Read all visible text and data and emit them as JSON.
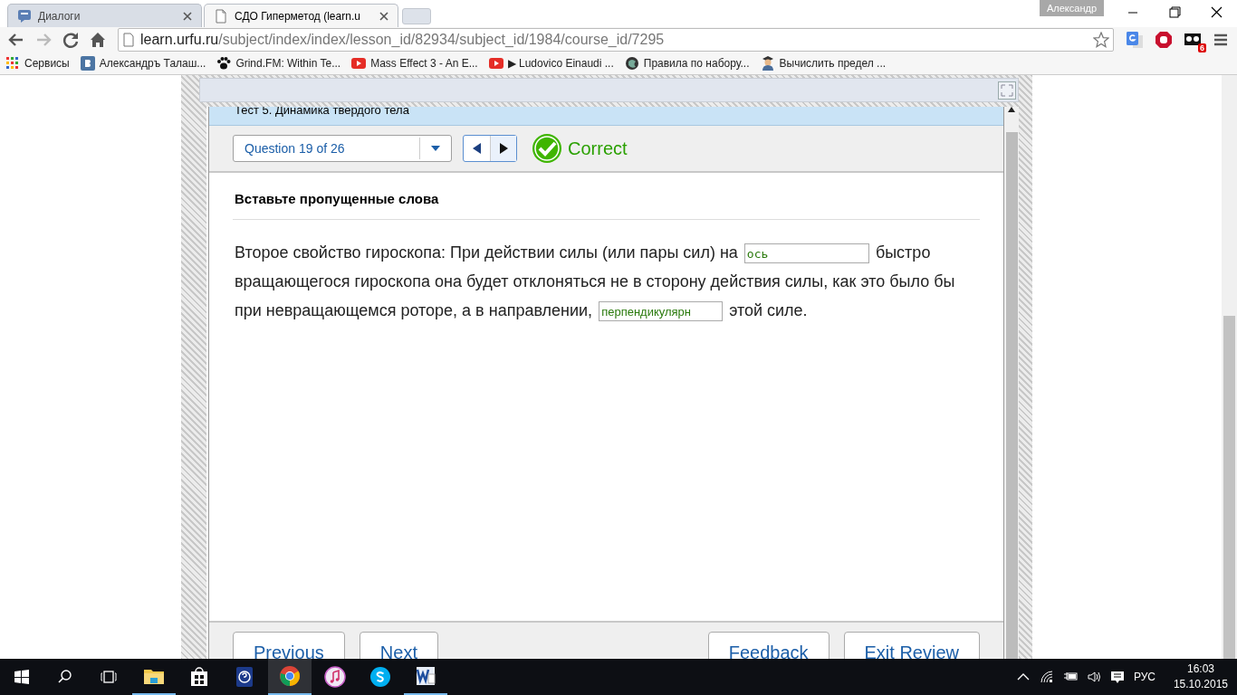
{
  "browser": {
    "tabs": [
      {
        "title": "Диалоги",
        "kind": "chat",
        "selected": false
      },
      {
        "title": "СДО Гиперметод (learn.u",
        "kind": "page",
        "selected": true
      }
    ],
    "profile": "Александр",
    "address": {
      "host": "learn.urfu.ru",
      "path": "/subject/index/index/lesson_id/82934/subject_id/1984/course_id/7295"
    },
    "extension_badge": "6",
    "bookmarks": [
      {
        "label": "Сервисы",
        "kind": "apps"
      },
      {
        "label": "Александръ Талаш...",
        "kind": "vk"
      },
      {
        "label": "Grind.FM: Within Te...",
        "kind": "paw"
      },
      {
        "label": "Mass Effect 3 - An E...",
        "kind": "video"
      },
      {
        "label": "▶ Ludovico Einaudi ...",
        "kind": "video"
      },
      {
        "label": "Правила по набору...",
        "kind": "globe"
      },
      {
        "label": "Вычислить предел ...",
        "kind": "person"
      }
    ]
  },
  "quiz": {
    "title": "Тест 5. Динамика твердого тела",
    "question_selector": "Question 19 of 26",
    "result": {
      "kind": "correct",
      "label": "Correct"
    },
    "heading": "Вставьте пропущенные слова",
    "parts": [
      {
        "kind": "text",
        "text": "Второе свойство гироскопа: При действии силы (или пары сил) на"
      },
      {
        "kind": "blank",
        "value": "ось"
      },
      {
        "kind": "text",
        "text": "быстро вращающегося гироскопа она  будет отклоняться не в сторону действия силы, как это было бы при невращающемся роторе, а в направлении,"
      },
      {
        "kind": "blank",
        "value": "перпендикулярн"
      },
      {
        "kind": "text",
        "text": "этой силе."
      }
    ],
    "left_buttons": [
      "Previous",
      "Next"
    ],
    "right_buttons": [
      "Feedback",
      "Exit Review"
    ]
  },
  "taskbar": {
    "apps": [
      {
        "kind": "folder",
        "running": true,
        "selected": false
      },
      {
        "kind": "store",
        "running": false,
        "selected": false
      },
      {
        "kind": "help",
        "running": false,
        "selected": false
      },
      {
        "kind": "chrome",
        "running": true,
        "selected": true
      },
      {
        "kind": "music",
        "running": false,
        "selected": false
      },
      {
        "kind": "skype",
        "running": false,
        "selected": false
      },
      {
        "kind": "word",
        "running": true,
        "selected": false
      }
    ],
    "language": "РУС",
    "time": "16:03",
    "date": "15.10.2015"
  }
}
